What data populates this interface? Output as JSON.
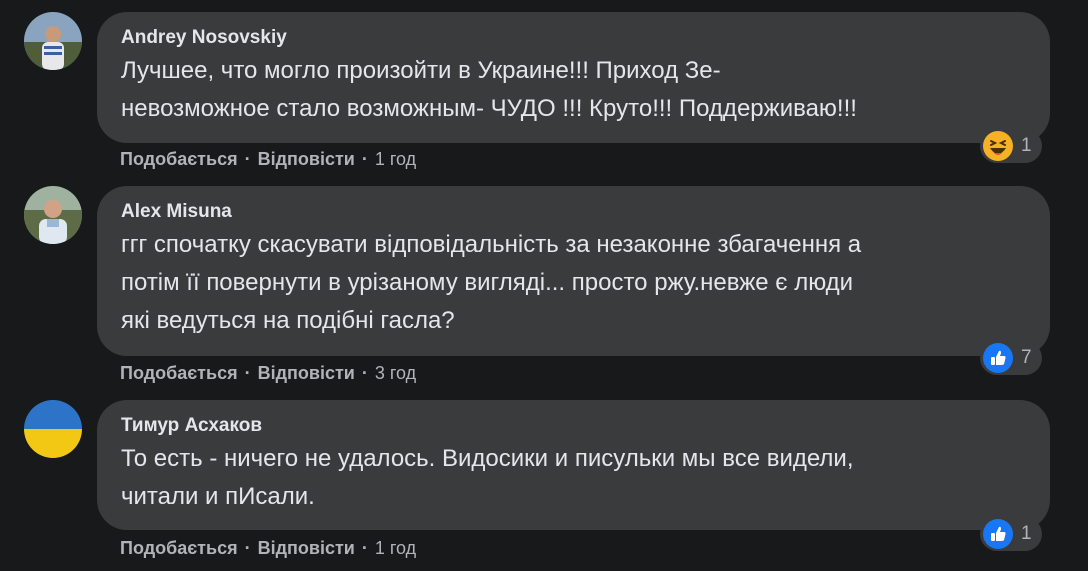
{
  "comments": [
    {
      "author": "Andrey Nosovskiy",
      "lines": [
        "Лучшее, что могло произойти в Украине!!! Приход Зе-",
        "невозможное стало возможным- ЧУДО !!! Круто!!! Поддерживаю!!!"
      ],
      "reaction": {
        "icon": "haha-emoji-icon",
        "count": "1"
      },
      "like_label": "Подобається",
      "reply_label": "Відповісти",
      "time": "1 год"
    },
    {
      "author": "Alex Misuna",
      "lines": [
        "ггг спочатку скасувати відповідальність за незаконне збагачення а",
        "потім її повернути в урізаному вигляді... просто ржу.невже є люди",
        "які ведуться на подібні гасла?"
      ],
      "reaction": {
        "icon": "like-thumb-icon",
        "count": "7"
      },
      "like_label": "Подобається",
      "reply_label": "Відповісти",
      "time": "3 год"
    },
    {
      "author": "Тимур Асхаков",
      "lines": [
        "То есть - ничего не удалось. Видосики и писульки мы все видели,",
        "читали и пИсали."
      ],
      "reaction": {
        "icon": "like-thumb-icon",
        "count": "1"
      },
      "like_label": "Подобається",
      "reply_label": "Відповісти",
      "time": "1 год"
    }
  ],
  "separator": "·",
  "colors": {
    "background": "#18191a",
    "bubble": "#3a3b3c",
    "text_primary": "#e4e6eb",
    "text_secondary": "#b0b3b8",
    "like_blue": "#1877f2",
    "haha_yellow": "#f7b125"
  }
}
